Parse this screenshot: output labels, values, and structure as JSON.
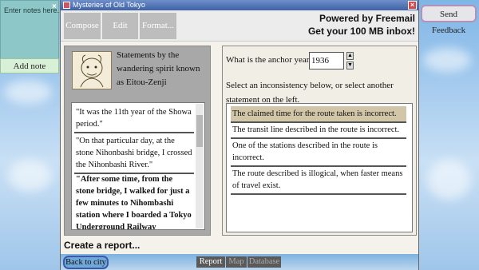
{
  "notes": {
    "placeholder": "Enter notes here...",
    "close": "×",
    "add_note": "Add note"
  },
  "feedback": {
    "label": "Send Feedback"
  },
  "window": {
    "title": "Mysteries of Old Tokyo",
    "close": "×",
    "toolbar": {
      "compose": "Compose",
      "edit": "Edit",
      "format": "Format..."
    },
    "ad": {
      "line1": "Powered by Freemail",
      "line2": "Get your 100 MB inbox!"
    }
  },
  "left": {
    "caption": "Statements by the wandering spirit known as Eitou-Zenji",
    "statements": [
      "\"It was the 11th year of the Showa period.\"",
      "\"On that particular day, at the stone Nihonbashi bridge, I crossed the Nihonbashi River.\"",
      "\"After some time, from the stone bridge, I walked for just a few minutes to Nihombashi station where I boarded a Tokyo Underground Railway"
    ]
  },
  "right": {
    "anchor_question": "What is the anchor year?",
    "anchor_year": "1936",
    "instructions": "Select an inconsistency below, or select another statement on the left.",
    "options": [
      "The claimed time for the route taken is incorrect.",
      "The transit line described in the route is incorrect.",
      "One of the stations described in the route is incorrect.",
      "The route described is illogical, when faster means of travel exist."
    ]
  },
  "bottom": {
    "create_report": "Create a report...",
    "back_to_city": "Back to city",
    "tabs": [
      "Report",
      "Map",
      "Database"
    ]
  },
  "colors": {
    "selected_option": "#d1c6a8",
    "titlebar": "#3f62a8",
    "toolbar_button": "#bdbdbd"
  }
}
